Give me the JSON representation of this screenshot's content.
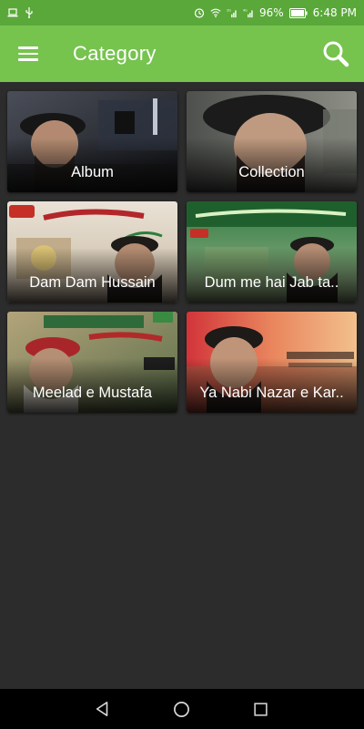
{
  "status_bar": {
    "battery_percent": "96%",
    "time": "6:48 PM",
    "network": "4G",
    "network_secondary": "2G"
  },
  "app_bar": {
    "title": "Category"
  },
  "categories": [
    {
      "label": "Album"
    },
    {
      "label": "Collection"
    },
    {
      "label": "Dam Dam Hussain"
    },
    {
      "label": "Dum me hai Jab ta.."
    },
    {
      "label": "Meelad e Mustafa"
    },
    {
      "label": "Ya Nabi Nazar e Kar.."
    }
  ],
  "colors": {
    "app_bar": "#76c34e",
    "status_bar": "#5aa83a",
    "background": "#2c2c2c"
  }
}
